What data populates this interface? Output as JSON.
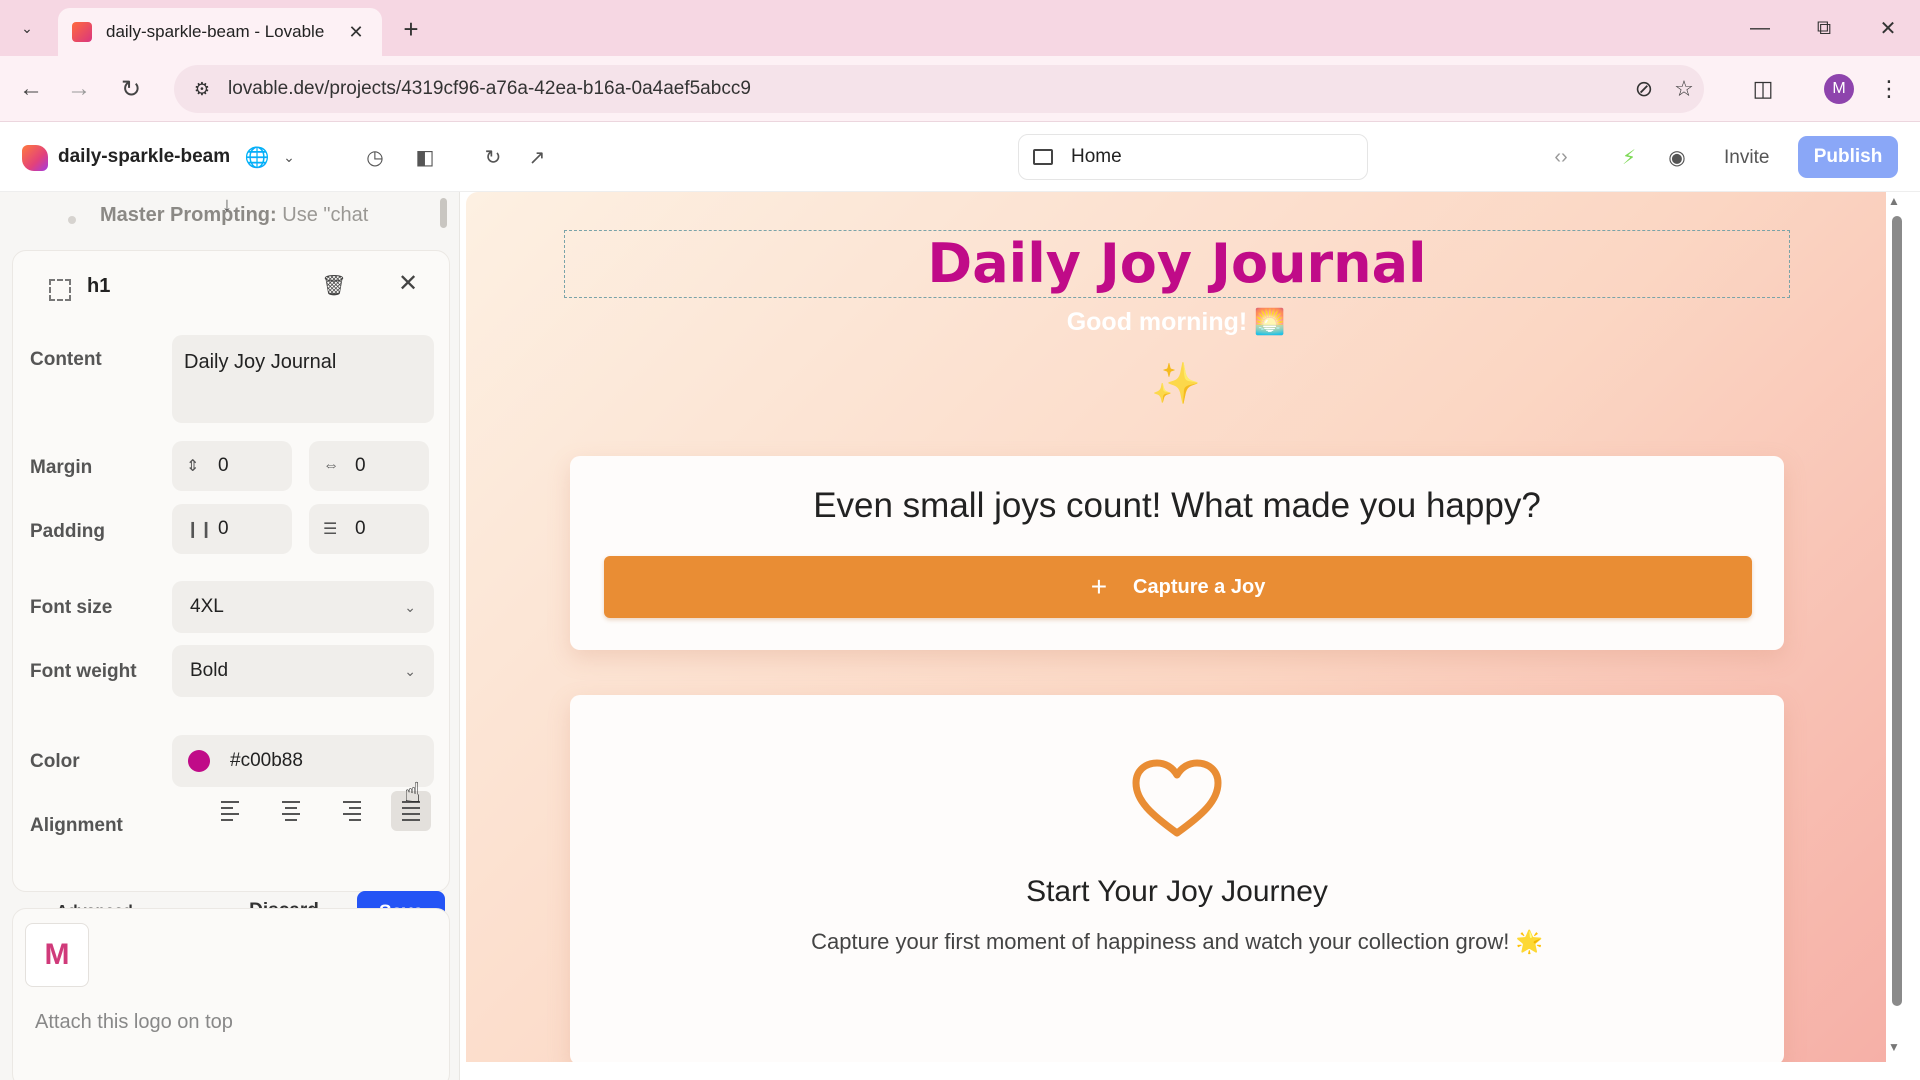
{
  "browser": {
    "tab_title": "daily-sparkle-beam - Lovable",
    "url": "lovable.dev/projects/4319cf96-a76a-42ea-b16a-0a4aef5abcc9",
    "profile_initial": "M"
  },
  "app": {
    "project_name": "daily-sparkle-beam",
    "page_selector": "Home",
    "invite_label": "Invite",
    "publish_label": "Publish",
    "accent_color": "#2454f5"
  },
  "panel": {
    "master_prompt_bold": "Master Prompting:",
    "master_prompt_text": " Use \"chat",
    "element_tag": "h1",
    "content_label": "Content",
    "content_value": "Daily Joy Journal",
    "margin_label": "Margin",
    "margin_vertical": "0",
    "margin_horizontal": "0",
    "padding_label": "Padding",
    "padding_horizontal": "0",
    "padding_vertical": "0",
    "font_size_label": "Font size",
    "font_size_value": "4XL",
    "font_weight_label": "Font weight",
    "font_weight_value": "Bold",
    "color_label": "Color",
    "color_value": "#c00b88",
    "alignment_label": "Alignment",
    "alignment_selected": "justify",
    "advanced_label": "Advanced",
    "discard_label": "Discard",
    "save_label": "Save"
  },
  "chat": {
    "attachment_icon": "colorful-m-logo",
    "message": "Attach this logo on top"
  },
  "preview": {
    "title": "Daily Joy Journal",
    "title_color": "#c00b88",
    "greeting": "Good morning! 🌅",
    "question": "Even small joys count! What made you happy?",
    "capture_button": "Capture a Joy",
    "capture_color": "#e98d34",
    "journey_title": "Start Your Joy Journey",
    "journey_subtitle": "Capture your first moment of happiness and watch your collection grow! 🌟"
  }
}
